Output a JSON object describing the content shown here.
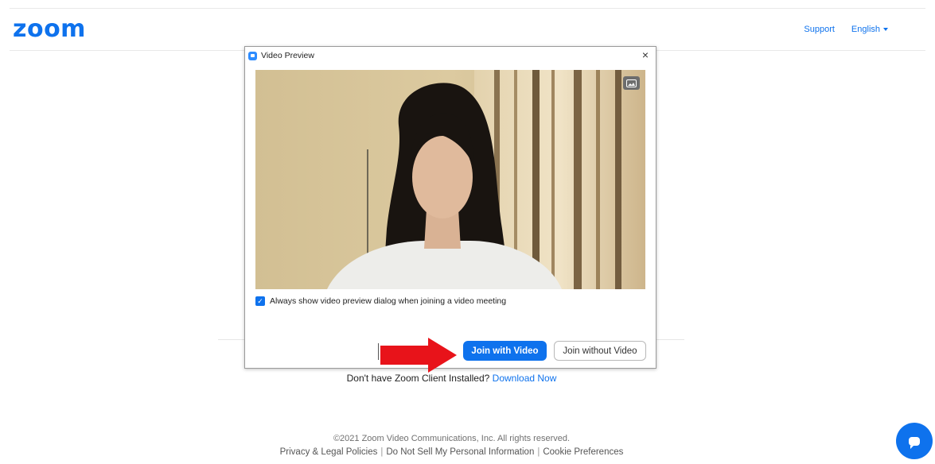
{
  "header": {
    "logo_text": "zoom",
    "nav": {
      "support": "Support",
      "language": "English"
    }
  },
  "dialog": {
    "title": "Video Preview",
    "close_symbol": "×",
    "checkbox_label": "Always show video preview dialog when joining a video meeting",
    "checkbox_checked": true,
    "join_with_video": "Join with Video",
    "join_without_video": "Join without Video",
    "icons": [
      "zoom-app-icon",
      "close-icon",
      "background-toggle-icon",
      "check-icon"
    ]
  },
  "page": {
    "download_prompt": "Don't have Zoom Client Installed?",
    "download_link": "Download Now"
  },
  "footer": {
    "copyright": "©2021 Zoom Video Communications, Inc. All rights reserved.",
    "links": [
      "Privacy & Legal Policies",
      "Do Not Sell My Personal Information",
      "Cookie Preferences"
    ],
    "separator": "|"
  },
  "colors": {
    "accent": "#0e72ed",
    "annotation_arrow": "#e8131a"
  }
}
